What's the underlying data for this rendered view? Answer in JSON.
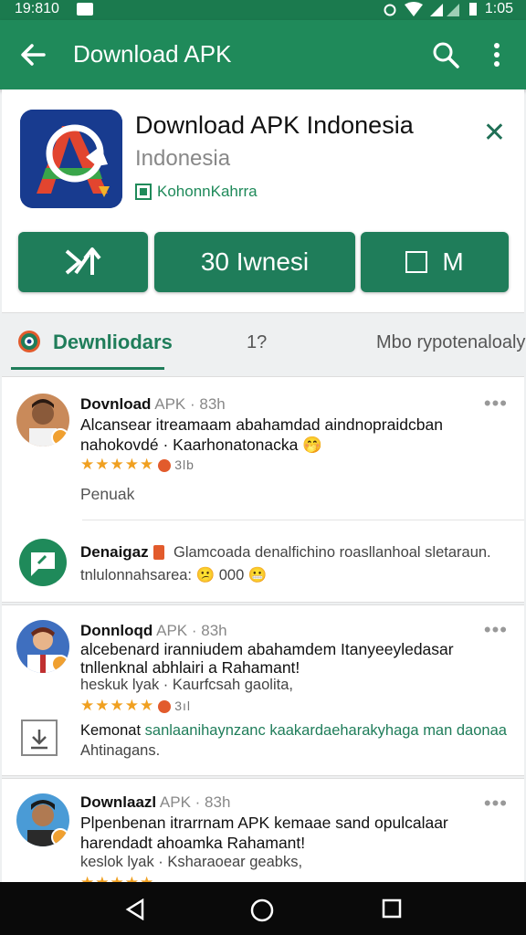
{
  "status": {
    "time": "19:810",
    "right_time": "1:05"
  },
  "appbar": {
    "title": "Download APK"
  },
  "app": {
    "name": "Download APK Indonesia",
    "subtitle": "Indonesia",
    "developer": "KohonnKahrra"
  },
  "buttons": {
    "b1_label": "",
    "b2_label": "30 Iwnesi",
    "b3_label": "M"
  },
  "tabs": {
    "active": "Dewnliodars",
    "middle": "1?",
    "right": "Mbo rypotenaloaly"
  },
  "reviews": [
    {
      "name": "Dovnload",
      "meta": "APK · 83h",
      "line1": "Alcansear itreamaam abahamdad aindnopraidcban",
      "line2": "nahokovdé · Kaarhonatonacka 🤭",
      "count": "3lb",
      "extra": "Penuak"
    },
    {
      "name": "Donnloqd",
      "meta": "APK · 83h",
      "line1": "alcebenard iranniudem abahamdem Itanyeeyledasar",
      "line2": "tnllenknal abhlairi a Rahamant!",
      "line3": "heskuk lyak · Kaurfcsah gaolita,",
      "count": "3ıl",
      "extra": ""
    },
    {
      "name": "Downlaazl",
      "meta": "APK · 83h",
      "line1": "Plpenbenan itrarrnam APK kemaae sand opulcalaar",
      "line2": "harendadt ahoamka Rahamant!",
      "line3": "keslok lyak · Ksharaoear geabks,",
      "count": "",
      "extra": ""
    }
  ],
  "replies": [
    {
      "label": "Denaigaz",
      "text1": "Glamcoada denalfichino roasllanhoal sletaraun.",
      "text2": "tnlulonnahsarea: 😕 000 😬"
    },
    {
      "label": "Kemonat",
      "text1": "sanlaanihaynzanc kaakardaeharakyhaga man daonaa",
      "text2": "Ahtinagans."
    }
  ],
  "colors": {
    "brand": "#1f8a5a",
    "button": "#1f7d5a",
    "star": "#f0a020"
  }
}
